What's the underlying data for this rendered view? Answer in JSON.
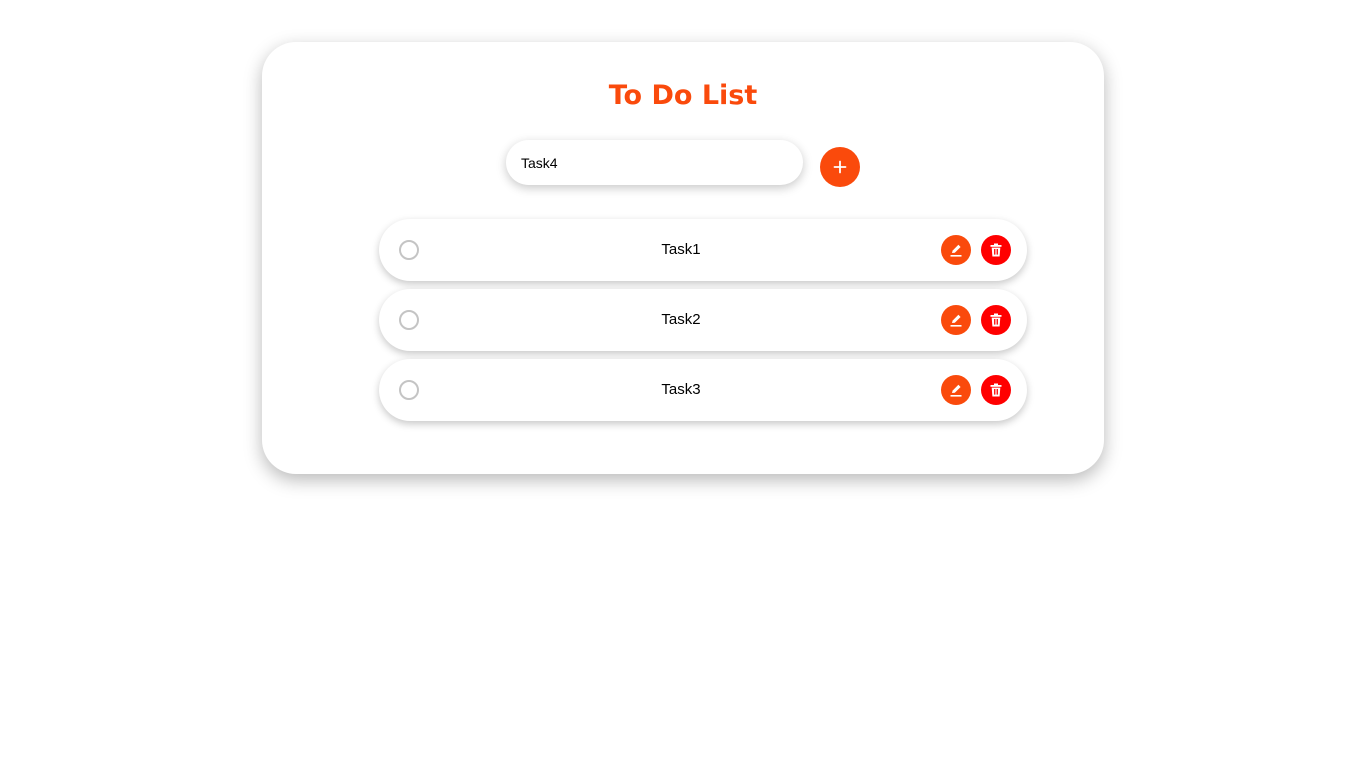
{
  "app": {
    "title": "To Do List"
  },
  "new_task": {
    "value": "Task4",
    "placeholder": ""
  },
  "add_button": {
    "icon": "plus-icon"
  },
  "tasks": [
    {
      "label": "Task1",
      "completed": false
    },
    {
      "label": "Task2",
      "completed": false
    },
    {
      "label": "Task3",
      "completed": false
    }
  ],
  "icons": {
    "edit": "pencil-icon",
    "delete": "trash-icon"
  },
  "colors": {
    "accent": "#fa4a0c",
    "delete": "#ff0000",
    "checkbox_border": "#c4c4c4"
  }
}
